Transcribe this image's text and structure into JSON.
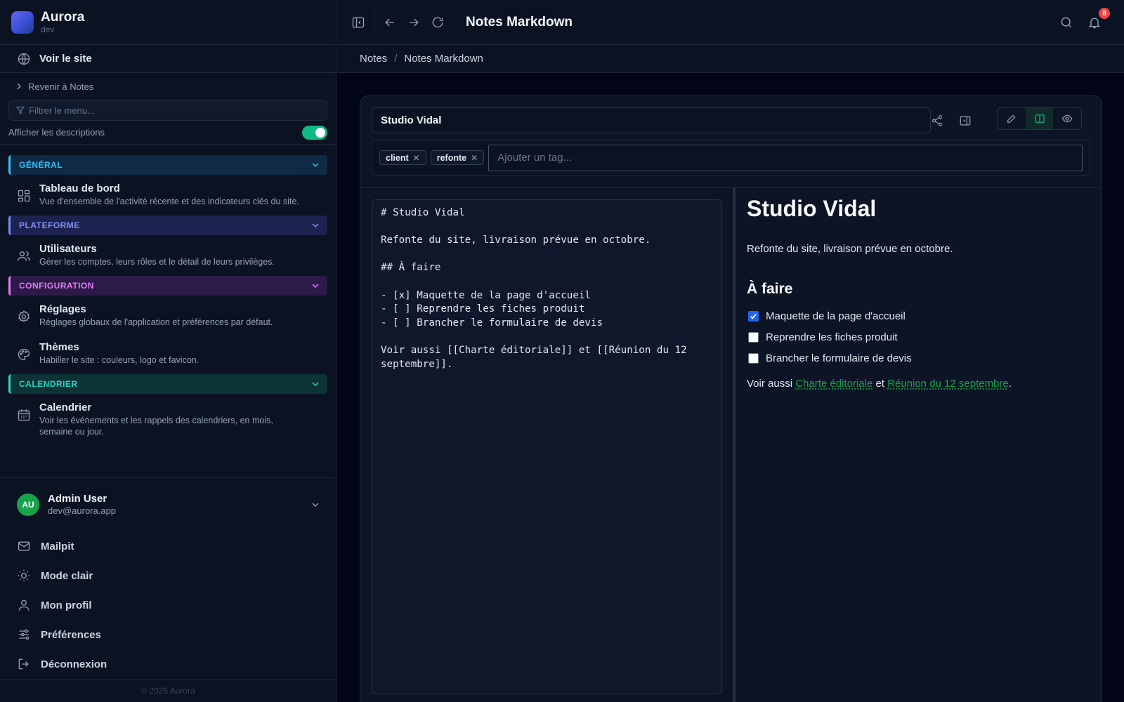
{
  "brand": {
    "name": "Aurora",
    "env": "dev"
  },
  "sidebar": {
    "view_site": "Voir le site",
    "back": "Revenir à Notes",
    "filter_placeholder": "Filtrer le menu...",
    "show_descriptions": "Afficher les descriptions",
    "show_descriptions_on": true,
    "sections": [
      {
        "label": "GÉNÉRAL",
        "color": "#38bdf8",
        "bg": "#0f2a44",
        "items": [
          {
            "title": "Tableau de bord",
            "desc": "Vue d'ensemble de l'activité récente et des indicateurs clés du site.",
            "icon": "dashboard-icon"
          }
        ]
      },
      {
        "label": "PLATEFORME",
        "color": "#818cf8",
        "bg": "#1c2350",
        "items": [
          {
            "title": "Utilisateurs",
            "desc": "Gérer les comptes, leurs rôles et le détail de leurs privilèges.",
            "icon": "users-icon"
          }
        ]
      },
      {
        "label": "CONFIGURATION",
        "color": "#e879f9",
        "bg": "#2d1a48",
        "items": [
          {
            "title": "Réglages",
            "desc": "Réglages globaux de l'application et préférences par défaut.",
            "icon": "gear-icon"
          },
          {
            "title": "Thèmes",
            "desc": "Habiller le site : couleurs, logo et favicon.",
            "icon": "palette-icon"
          }
        ]
      },
      {
        "label": "CALENDRIER",
        "color": "#2dd4bf",
        "bg": "#0d3336",
        "items": [
          {
            "title": "Calendrier",
            "desc": "Voir les événements et les rappels des calendriers, en mois, semaine ou jour.",
            "icon": "calendar-icon"
          }
        ]
      }
    ],
    "user": {
      "initials": "AU",
      "name": "Admin User",
      "email": "dev@aurora.app"
    },
    "bottom_items": [
      {
        "label": "Mailpit",
        "icon": "mail-icon"
      },
      {
        "label": "Mode clair",
        "icon": "sun-icon"
      },
      {
        "label": "Mon profil",
        "icon": "user-icon"
      },
      {
        "label": "Préférences",
        "icon": "sliders-icon"
      },
      {
        "label": "Déconnexion",
        "icon": "logout-icon"
      }
    ],
    "footer": "© 2026 Aurora"
  },
  "header": {
    "title": "Notes Markdown",
    "notification_count": "8"
  },
  "breadcrumb": {
    "parent": "Notes",
    "separator": "/",
    "current": "Notes Markdown"
  },
  "note": {
    "title": "Studio Vidal",
    "tags": [
      "client",
      "refonte"
    ],
    "tag_placeholder": "Ajouter un tag...",
    "view_mode": "split",
    "markdown": "# Studio Vidal\n\nRefonte du site, livraison prévue en octobre.\n\n## À faire\n\n- [x] Maquette de la page d'accueil\n- [ ] Reprendre les fiches produit\n- [ ] Brancher le formulaire de devis\n\nVoir aussi [[Charte éditoriale]] et [[Réunion du 12 septembre]].",
    "preview": {
      "h1": "Studio Vidal",
      "paragraph": "Refonte du site, livraison prévue en octobre.",
      "h2": "À faire",
      "tasks": [
        {
          "label": "Maquette de la page d'accueil",
          "done": true
        },
        {
          "label": "Reprendre les fiches produit",
          "done": false
        },
        {
          "label": "Brancher le formulaire de devis",
          "done": false
        }
      ],
      "see_also_prefix": "Voir aussi",
      "link1": "Charte éditoriale",
      "conj": "et",
      "link2": "Réunion du 12 septembre",
      "end": "."
    }
  },
  "colors": {
    "accent": "#10b981",
    "link": "#16a34a",
    "checkbox": "#2563eb",
    "badge": "#ef4444"
  }
}
